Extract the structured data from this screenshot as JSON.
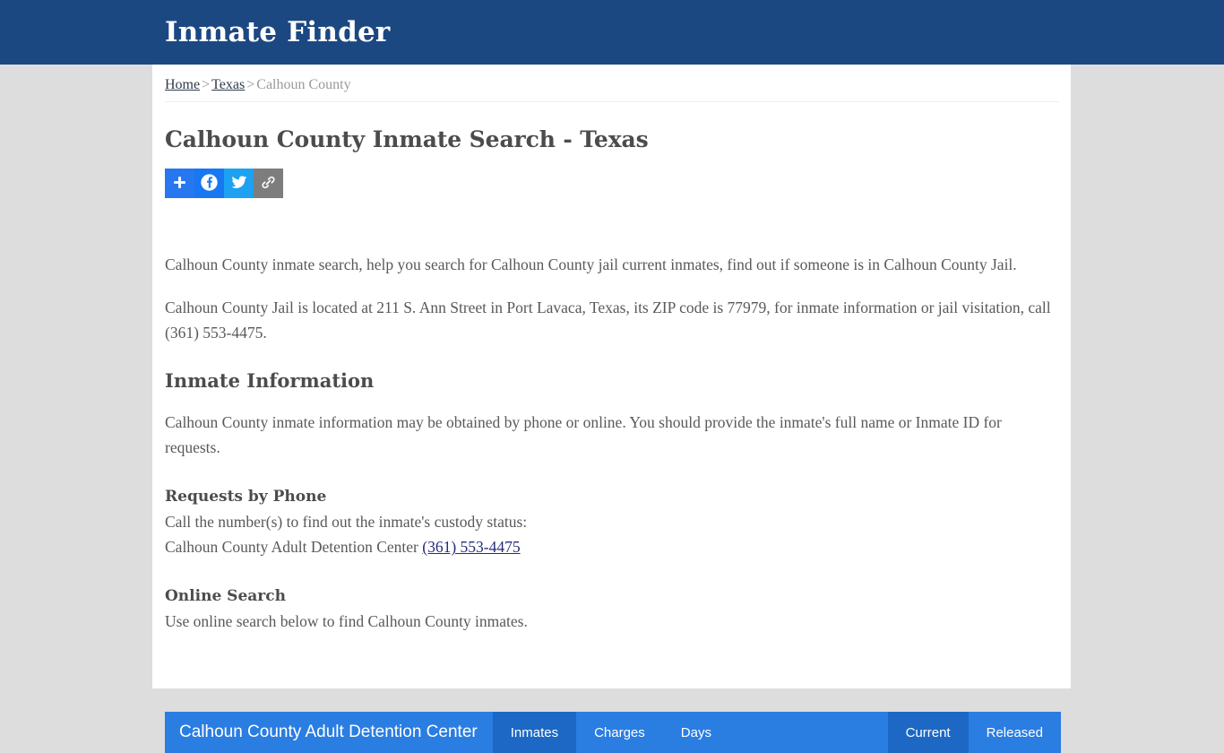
{
  "header": {
    "title": "Inmate Finder"
  },
  "breadcrumb": {
    "home": "Home",
    "sep1": ">",
    "state": "Texas",
    "sep2": ">",
    "current": "Calhoun County"
  },
  "page": {
    "title": "Calhoun County Inmate Search - Texas"
  },
  "share": {
    "addthis_label": "+",
    "facebook_label": "f",
    "twitter_label": "t",
    "link_label": "link"
  },
  "body": {
    "intro": "Calhoun County inmate search, help you search for Calhoun County jail current inmates, find out if someone is in Calhoun County Jail.",
    "address": "Calhoun County Jail is located at 211 S. Ann Street in Port Lavaca, Texas, its ZIP code is 77979, for inmate information or jail visitation, call (361) 553-4475.",
    "inmate_info_heading": "Inmate Information",
    "inmate_info_text": "Calhoun County inmate information may be obtained by phone or online. You should provide the inmate's full name or Inmate ID for requests.",
    "requests_by_phone_heading": "Requests by Phone",
    "requests_by_phone_line1": "Call the number(s) to find out the inmate's custody status:",
    "requests_by_phone_facility": "Calhoun County Adult Detention Center",
    "requests_by_phone_number": "(361) 553-4475",
    "online_search_heading": "Online Search",
    "online_search_text": "Use online search below to find Calhoun County inmates."
  },
  "widget": {
    "title": "Calhoun County Adult Detention Center",
    "tabs": [
      {
        "label": "Inmates",
        "active": true
      },
      {
        "label": "Charges",
        "active": false
      },
      {
        "label": "Days",
        "active": false
      }
    ],
    "status_tabs": [
      {
        "label": "Current",
        "active": true
      },
      {
        "label": "Released",
        "active": false
      }
    ]
  },
  "colors": {
    "header_blue": "#1c4882",
    "widget_blue": "#2a7de1",
    "widget_active_blue": "#1c68c4",
    "page_bg": "#dddddd",
    "link_blue": "#232c7c"
  }
}
